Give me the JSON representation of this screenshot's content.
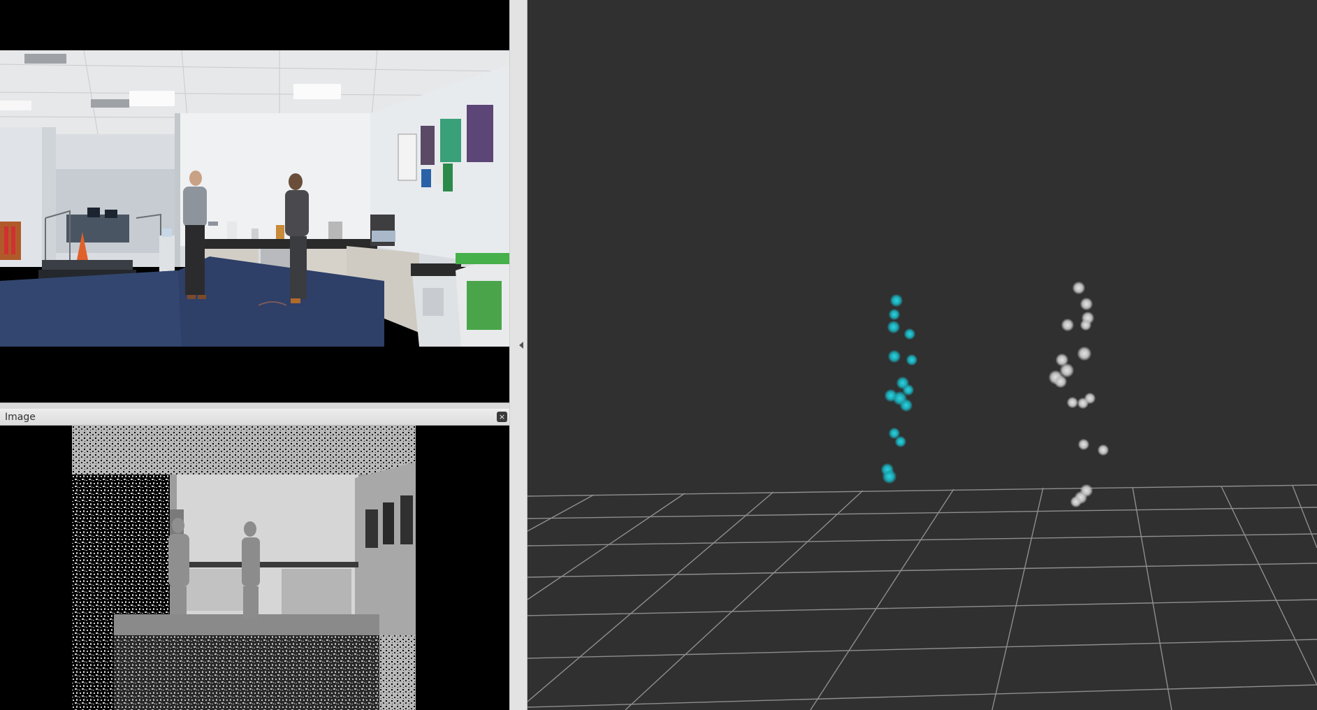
{
  "image_panel": {
    "title": "Image",
    "close_icon": "close-icon",
    "close_glyph": "×"
  },
  "panels": {
    "camera_feed": {
      "kind": "rgb-camera-image"
    },
    "depth_feed": {
      "kind": "grayscale-depth-image"
    },
    "view_3d": {
      "kind": "3d-visualization",
      "background_color": "#303030",
      "grid_color": "#a0a0a0",
      "marker_colors": [
        "#1fb8c4",
        "#d4d4d4"
      ]
    }
  },
  "splitter": {
    "arrow_icon": "chevron-left-icon"
  }
}
